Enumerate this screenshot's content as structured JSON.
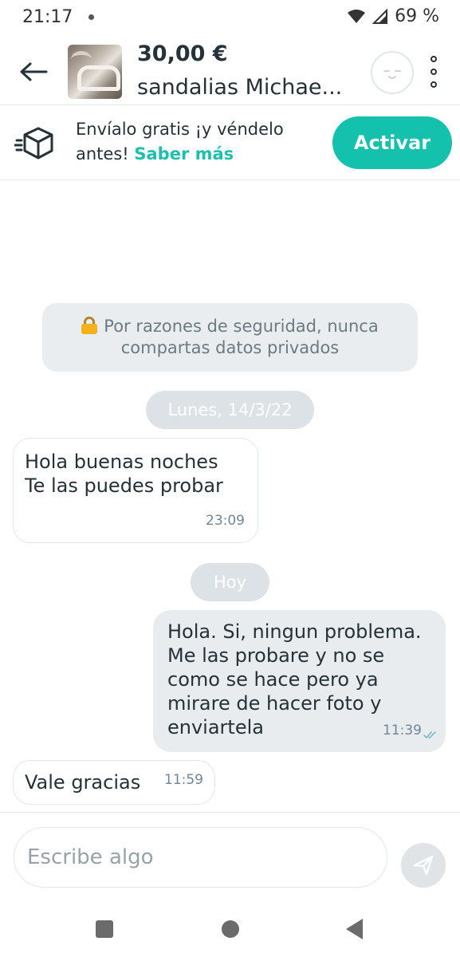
{
  "status_bar": {
    "time": "21:17",
    "battery": "69 %",
    "icons": [
      "notification-dot-icon",
      "wifi-icon",
      "signal-icon"
    ]
  },
  "header": {
    "back_icon": "arrow-left-icon",
    "price": "30,00 €",
    "title": "sandalias Michae...",
    "avatar_icon": "user-avatar-icon",
    "menu_icon": "more-vertical-icon"
  },
  "shipping_banner": {
    "icon": "fast-box-icon",
    "text": "Envíalo gratis ¡y véndelo antes!",
    "link": "Saber más",
    "button": "Activar"
  },
  "chat": {
    "security_note": "Por razones de seguridad, nunca compartas datos privados",
    "date_separators": [
      "Lunes, 14/3/22",
      "Hoy"
    ],
    "messages": [
      {
        "direction": "incoming",
        "text": "Hola buenas noches\nTe las puedes probar",
        "time": "23:09"
      },
      {
        "direction": "outgoing",
        "text": "Hola.  Si, ningun problema. Me las probare y no se como se hace pero ya mirare de hacer foto y enviartela",
        "time": "11:39",
        "read": true
      },
      {
        "direction": "incoming",
        "text": "Vale gracias",
        "time": "11:59"
      }
    ]
  },
  "composer": {
    "placeholder": "Escribe algo",
    "send_icon": "send-icon"
  },
  "colors": {
    "accent": "#13c1ac",
    "text": "#253238",
    "bubble_outgoing": "#e8ecef",
    "date_pill": "#dde2e6"
  }
}
